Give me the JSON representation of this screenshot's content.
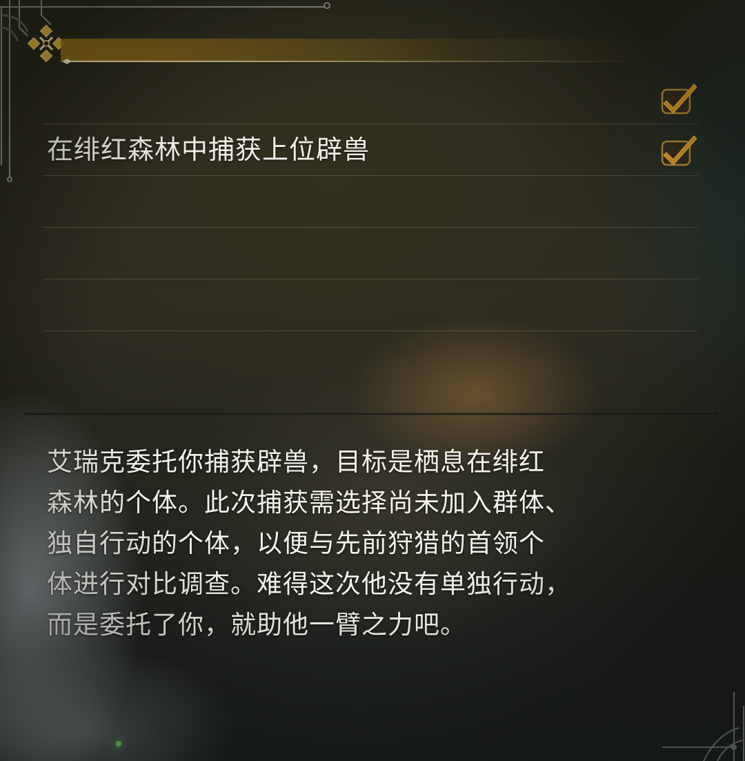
{
  "header": {
    "emblem_icon": "crossed-diamond-emblem-icon",
    "title": ""
  },
  "tasks": [
    {
      "label": "",
      "completed": true,
      "check_icon": "checkmark-icon"
    },
    {
      "label": "在绯红森林中捕获上位辟兽",
      "completed": true,
      "check_icon": "checkmark-icon"
    },
    {
      "label": "",
      "completed": false
    },
    {
      "label": "",
      "completed": false
    },
    {
      "label": "",
      "completed": false
    }
  ],
  "description": {
    "lines": [
      "艾瑞克委托你捕获辟兽，目标是栖息在绯红",
      "森林的个体。此次捕获需选择尚未加入群体、",
      "独自行动的个体，以便与先前狩猎的首领个",
      "体进行对比调查。难得这次他没有单独行动，",
      "而是委托了你，就助他一臂之力吧。"
    ]
  },
  "colors": {
    "accent_gold": "#e8a21c",
    "check_fill": "#f0a020",
    "text": "#f1efe8"
  }
}
